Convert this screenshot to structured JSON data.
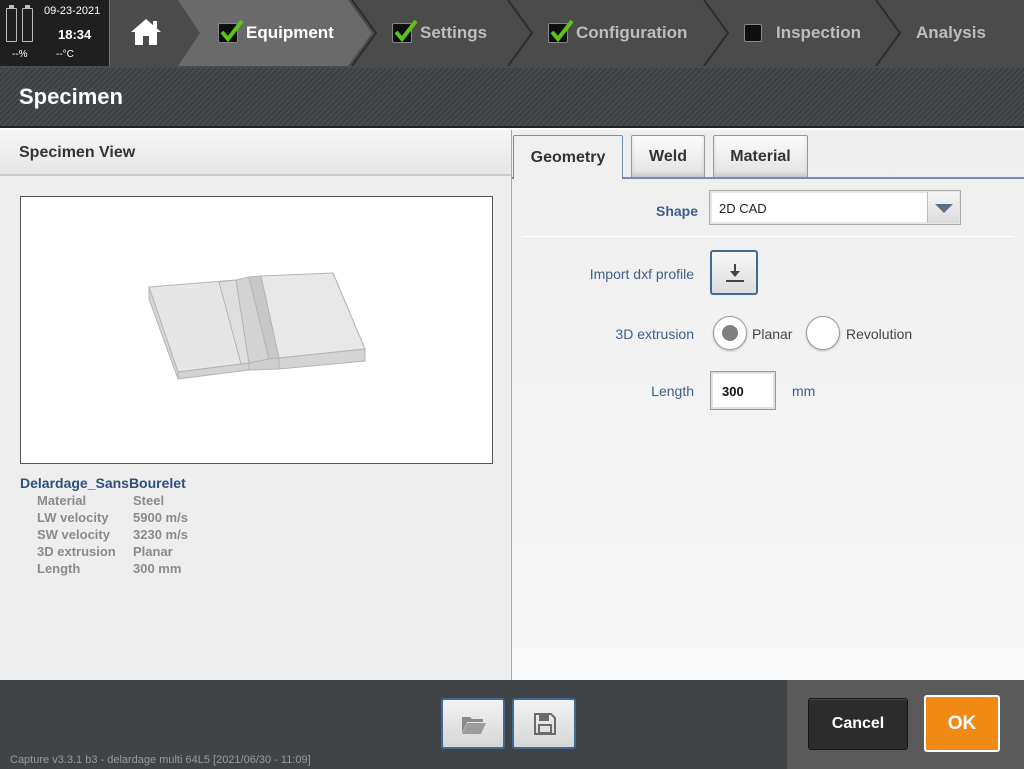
{
  "status": {
    "date": "09-23-2021",
    "time": "18:34",
    "battery": "--%",
    "temperature": "--°C"
  },
  "breadcrumb": [
    {
      "label": "Equipment",
      "checked": true,
      "active": true
    },
    {
      "label": "Settings",
      "checked": true,
      "active": false
    },
    {
      "label": "Configuration",
      "checked": true,
      "active": false
    },
    {
      "label": "Inspection",
      "checked": false,
      "active": false
    },
    {
      "label": "Analysis",
      "checked": false,
      "active": false
    }
  ],
  "page": {
    "title": "Specimen"
  },
  "left_panel": {
    "title": "Specimen View",
    "specimen_name": "Delardage_SansBourelet",
    "properties": [
      {
        "label": "Material",
        "value": "Steel"
      },
      {
        "label": "LW velocity",
        "value": "5900 m/s"
      },
      {
        "label": "SW velocity",
        "value": "3230 m/s"
      },
      {
        "label": "3D extrusion",
        "value": "Planar"
      },
      {
        "label": "Length",
        "value": "300 mm"
      }
    ]
  },
  "tabs": [
    {
      "label": "Geometry",
      "active": true
    },
    {
      "label": "Weld",
      "active": false
    },
    {
      "label": "Material",
      "active": false
    }
  ],
  "form": {
    "shape_label": "Shape",
    "shape_value": "2D CAD",
    "import_label": "Import dxf profile",
    "extrusion_label": "3D extrusion",
    "extrusion_options": [
      {
        "label": "Planar",
        "selected": true
      },
      {
        "label": "Revolution",
        "selected": false
      }
    ],
    "length_label": "Length",
    "length_value": "300",
    "length_unit": "mm"
  },
  "footer": {
    "cancel_label": "Cancel",
    "ok_label": "OK",
    "version": "Capture v3.3.1 b3 - delardage multi 64L5 [2021/06/30 - 11:09]"
  },
  "colors": {
    "ok_button": "#f08a14",
    "label_blue": "#3d5f8a",
    "check_green": "#5cc31d"
  },
  "icons": [
    "home-icon",
    "check-icon",
    "chevron-down-icon",
    "download-icon",
    "folder-open-icon",
    "save-icon"
  ]
}
